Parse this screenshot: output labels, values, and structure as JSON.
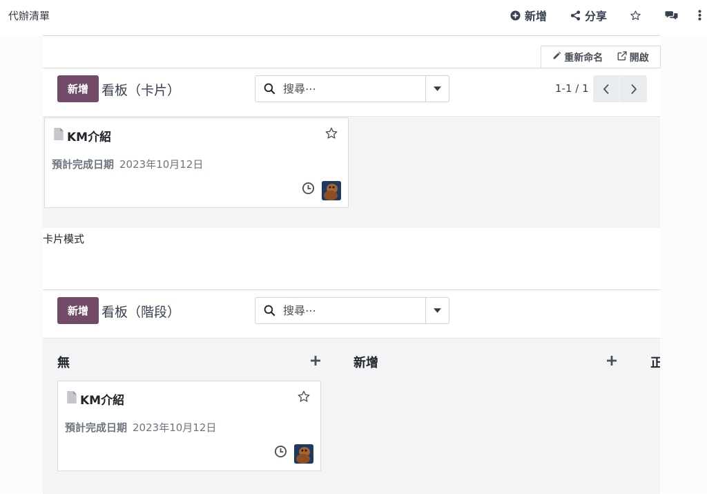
{
  "topbar": {
    "title": "代辦清單",
    "new_label": "新增",
    "share_label": "分享"
  },
  "knowledge_toolbar": {
    "rename_label": "重新命名",
    "open_label": "開啟"
  },
  "card_view": {
    "new_button": "新增",
    "title": "看板（卡片）",
    "search_placeholder": "搜尋⋯",
    "pager": "1-1 / 1",
    "card": {
      "title": "KM介紹",
      "deadline_label": "預計完成日期",
      "deadline_value": "2023年10月12日"
    },
    "caption": "卡片模式"
  },
  "stage_view": {
    "new_button": "新增",
    "title": "看板（階段）",
    "search_placeholder": "搜尋⋯",
    "columns": [
      {
        "name": "無"
      },
      {
        "name": "新增"
      },
      {
        "name": "正"
      }
    ],
    "card": {
      "title": "KM介紹",
      "deadline_label": "預計完成日期",
      "deadline_value": "2023年10月12日"
    }
  },
  "colors": {
    "primary": "#714B67",
    "kanban_bg": "#f3f4f6"
  },
  "icons": [
    "plus-circle-icon",
    "share-icon",
    "star-icon",
    "chat-icon",
    "more-icon",
    "pencil-icon",
    "external-link-icon",
    "search-icon",
    "caret-down-icon",
    "chevron-left-icon",
    "chevron-right-icon",
    "file-icon",
    "clock-icon",
    "plus-icon"
  ]
}
